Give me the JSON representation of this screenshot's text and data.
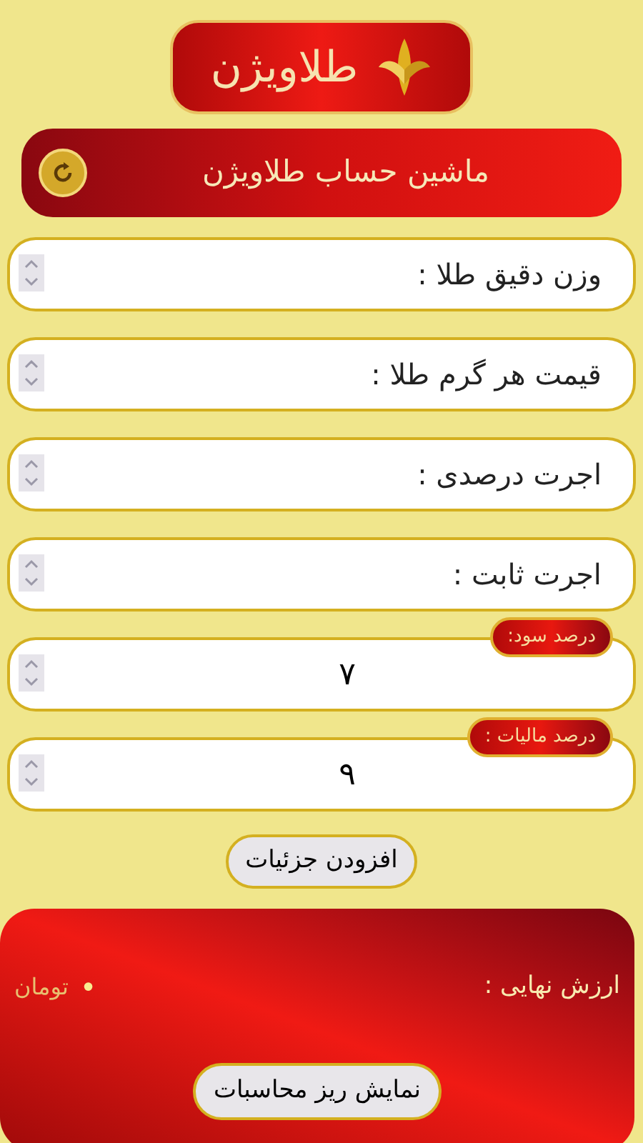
{
  "logo": {
    "text": "طلاویژن"
  },
  "header": {
    "title": "ماشین حساب طلاویژن"
  },
  "fields": [
    {
      "kind": "plain",
      "placeholder": "وزن دقیق طلا :"
    },
    {
      "kind": "plain",
      "placeholder": "قیمت هر گرم طلا :"
    },
    {
      "kind": "plain",
      "placeholder": "اجرت درصدی :"
    },
    {
      "kind": "plain",
      "placeholder": "اجرت ثابت :"
    },
    {
      "kind": "badged",
      "badge": "درصد سود:",
      "value": "۷"
    },
    {
      "kind": "badged",
      "badge": "درصد مالیات :",
      "value": "۹"
    }
  ],
  "add_details_button": "افزودن جزئیات",
  "result": {
    "label": "ارزش نهایی :",
    "value": "•",
    "unit": "تومان",
    "details_button": "نمایش ریز محاسبات"
  }
}
